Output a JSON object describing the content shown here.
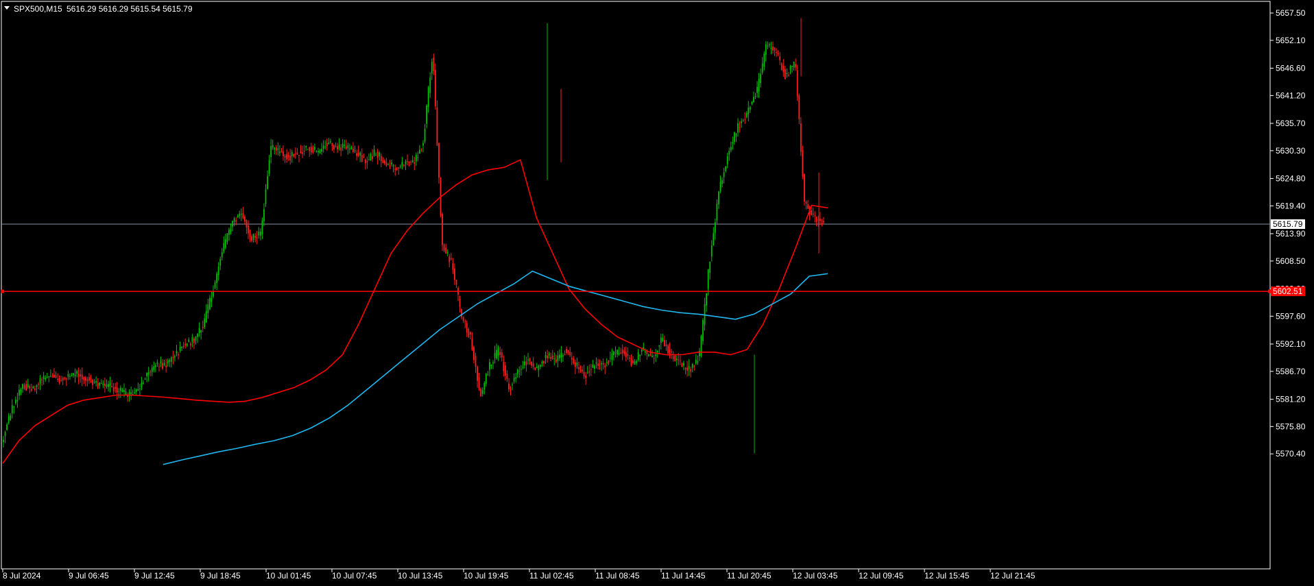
{
  "chart_header": {
    "symbol": "SPX500,M15",
    "ohlc": "5616.29 5616.29 5615.54 5615.79"
  },
  "price_axis": {
    "ticks": [
      "5657.50",
      "5652.10",
      "5646.60",
      "5641.20",
      "5635.70",
      "5630.30",
      "5624.80",
      "5619.40",
      "5613.90",
      "5608.50",
      "5603.00",
      "5597.60",
      "5592.10",
      "5586.70",
      "5581.20",
      "5575.80",
      "5570.40"
    ],
    "current_price_label": "5615.79",
    "hline_label": "5602.51"
  },
  "time_axis": {
    "ticks": [
      "8 Jul 2024",
      "9 Jul 06:45",
      "9 Jul 12:45",
      "9 Jul 18:45",
      "10 Jul 01:45",
      "10 Jul 07:45",
      "10 Jul 13:45",
      "10 Jul 19:45",
      "11 Jul 02:45",
      "11 Jul 08:45",
      "11 Jul 14:45",
      "11 Jul 20:45",
      "12 Jul 03:45",
      "12 Jul 09:45",
      "12 Jul 15:45",
      "12 Jul 21:45"
    ]
  },
  "colors": {
    "background": "#000000",
    "bull": "#00c000",
    "bear": "#ff2020",
    "ma_fast": "#ff0000",
    "ma_slow": "#1fb8f0",
    "hline": "#ff0000",
    "bid_line": "#8a93a5",
    "axis": "#ffffff"
  },
  "chart_data": {
    "type": "line",
    "ylim": [
      5568,
      5659
    ],
    "series": [
      {
        "values": [
          5574,
          5580,
          5584,
          5583,
          5585,
          5586,
          5585,
          5586,
          5586,
          5585,
          5584,
          5584,
          5583,
          5582,
          5583,
          5586,
          5588,
          5588,
          5590,
          5592,
          5593,
          5596,
          5603,
          5611,
          5616,
          5618,
          5613,
          5614,
          5631,
          5630,
          5629,
          5630,
          5631,
          5630,
          5632,
          5631,
          5631,
          5630,
          5628,
          5630,
          5628,
          5627,
          5628,
          5628,
          5632,
          5650,
          5612,
          5608,
          5598,
          5593,
          5582,
          5588,
          5591,
          5583,
          5587,
          5589,
          5587,
          5590,
          5589,
          5591,
          5588,
          5586,
          5588,
          5588,
          5590,
          5591,
          5588,
          5591,
          5589,
          5593,
          5590,
          5588,
          5587,
          5590,
          5608,
          5622,
          5630,
          5635,
          5638,
          5642,
          5651,
          5650,
          5645,
          5648,
          5620,
          5617,
          5616
        ]
      },
      {
        "values": [
          5568.5,
          5573,
          5576,
          5578,
          5580,
          5581,
          5581.5,
          5582,
          5582,
          5581.8,
          5581.6,
          5581.3,
          5581,
          5580.8,
          5580.6,
          5580.8,
          5581.5,
          5582.5,
          5583.5,
          5585,
          5587,
          5590,
          5596,
          5603,
          5610,
          5614.5,
          5618,
          5621,
          5623.5,
          5625.5,
          5626.5,
          5627,
          5628.5,
          5617,
          5610,
          5603,
          5599,
          5596,
          5593.5,
          5592,
          5590.5,
          5590,
          5590,
          5590.5,
          5590.5,
          5590,
          5591,
          5596,
          5603,
          5611,
          5619.5,
          5619
        ]
      },
      {
        "values": [
          5568.3,
          5569.2,
          5570,
          5570.8,
          5571.5,
          5572.3,
          5573,
          5574,
          5575.5,
          5577.5,
          5580,
          5583,
          5586,
          5589,
          5592,
          5595,
          5597.5,
          5600,
          5602,
          5604,
          5606.5,
          5605,
          5603.5,
          5602.5,
          5601.5,
          5600.5,
          5599.5,
          5598.8,
          5598.3,
          5598,
          5597.5,
          5597,
          5598,
          5600,
          5602,
          5605.5,
          5606
        ]
      }
    ]
  }
}
